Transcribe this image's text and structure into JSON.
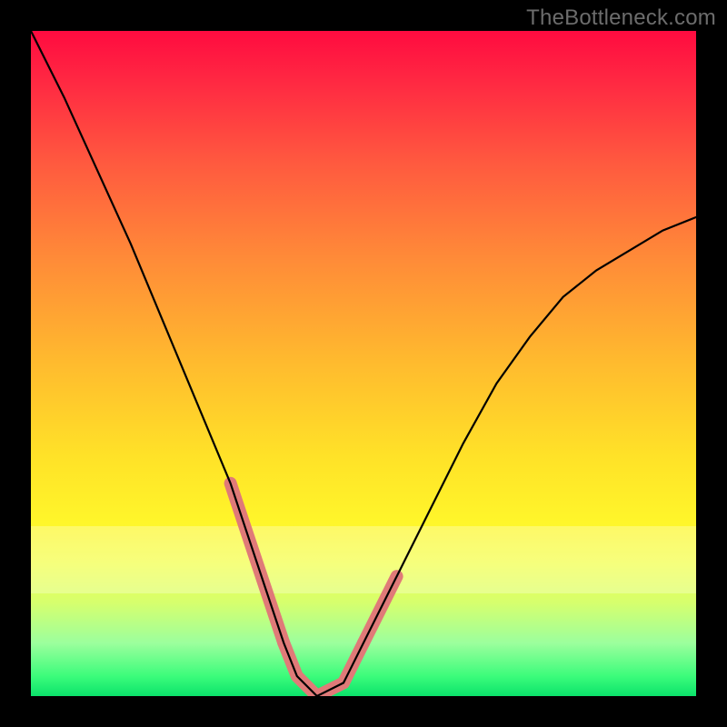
{
  "watermark": "TheBottleneck.com",
  "chart_data": {
    "type": "line",
    "title": "",
    "xlabel": "",
    "ylabel": "",
    "xlim": [
      0,
      100
    ],
    "ylim": [
      0,
      100
    ],
    "legend": false,
    "grid": false,
    "annotations": [],
    "series": [
      {
        "name": "bottleneck-curve",
        "x": [
          0,
          5,
          10,
          15,
          20,
          25,
          30,
          32,
          35,
          38,
          40,
          43,
          47,
          50,
          55,
          60,
          65,
          70,
          75,
          80,
          85,
          90,
          95,
          100
        ],
        "values": [
          100,
          90,
          79,
          68,
          56,
          44,
          32,
          26,
          17,
          8,
          3,
          0,
          2,
          8,
          18,
          28,
          38,
          47,
          54,
          60,
          64,
          67,
          70,
          72
        ]
      },
      {
        "name": "highlight-left",
        "x": [
          30,
          32,
          35,
          38
        ],
        "values": [
          32,
          26,
          17,
          8
        ]
      },
      {
        "name": "highlight-bottom",
        "x": [
          38,
          40,
          43,
          47
        ],
        "values": [
          8,
          3,
          0,
          2
        ]
      },
      {
        "name": "highlight-right",
        "x": [
          47,
          50
        ],
        "values": [
          2,
          8
        ]
      },
      {
        "name": "highlight-right-upper",
        "x": [
          50,
          55
        ],
        "values": [
          8,
          18
        ]
      }
    ],
    "gradient_stops": [
      {
        "pos": 0,
        "color": "#ff0b40"
      },
      {
        "pos": 8,
        "color": "#ff2a42"
      },
      {
        "pos": 20,
        "color": "#ff5a3f"
      },
      {
        "pos": 34,
        "color": "#ff8a38"
      },
      {
        "pos": 50,
        "color": "#ffbb2e"
      },
      {
        "pos": 64,
        "color": "#ffe228"
      },
      {
        "pos": 74,
        "color": "#fff62a"
      },
      {
        "pos": 80,
        "color": "#f3ff4a"
      },
      {
        "pos": 86,
        "color": "#d6ff6e"
      },
      {
        "pos": 92,
        "color": "#9cff9d"
      },
      {
        "pos": 97,
        "color": "#3cfc7b"
      },
      {
        "pos": 100,
        "color": "#0be36b"
      }
    ],
    "pale_band_y_range": [
      74.5,
      84.5
    ]
  }
}
